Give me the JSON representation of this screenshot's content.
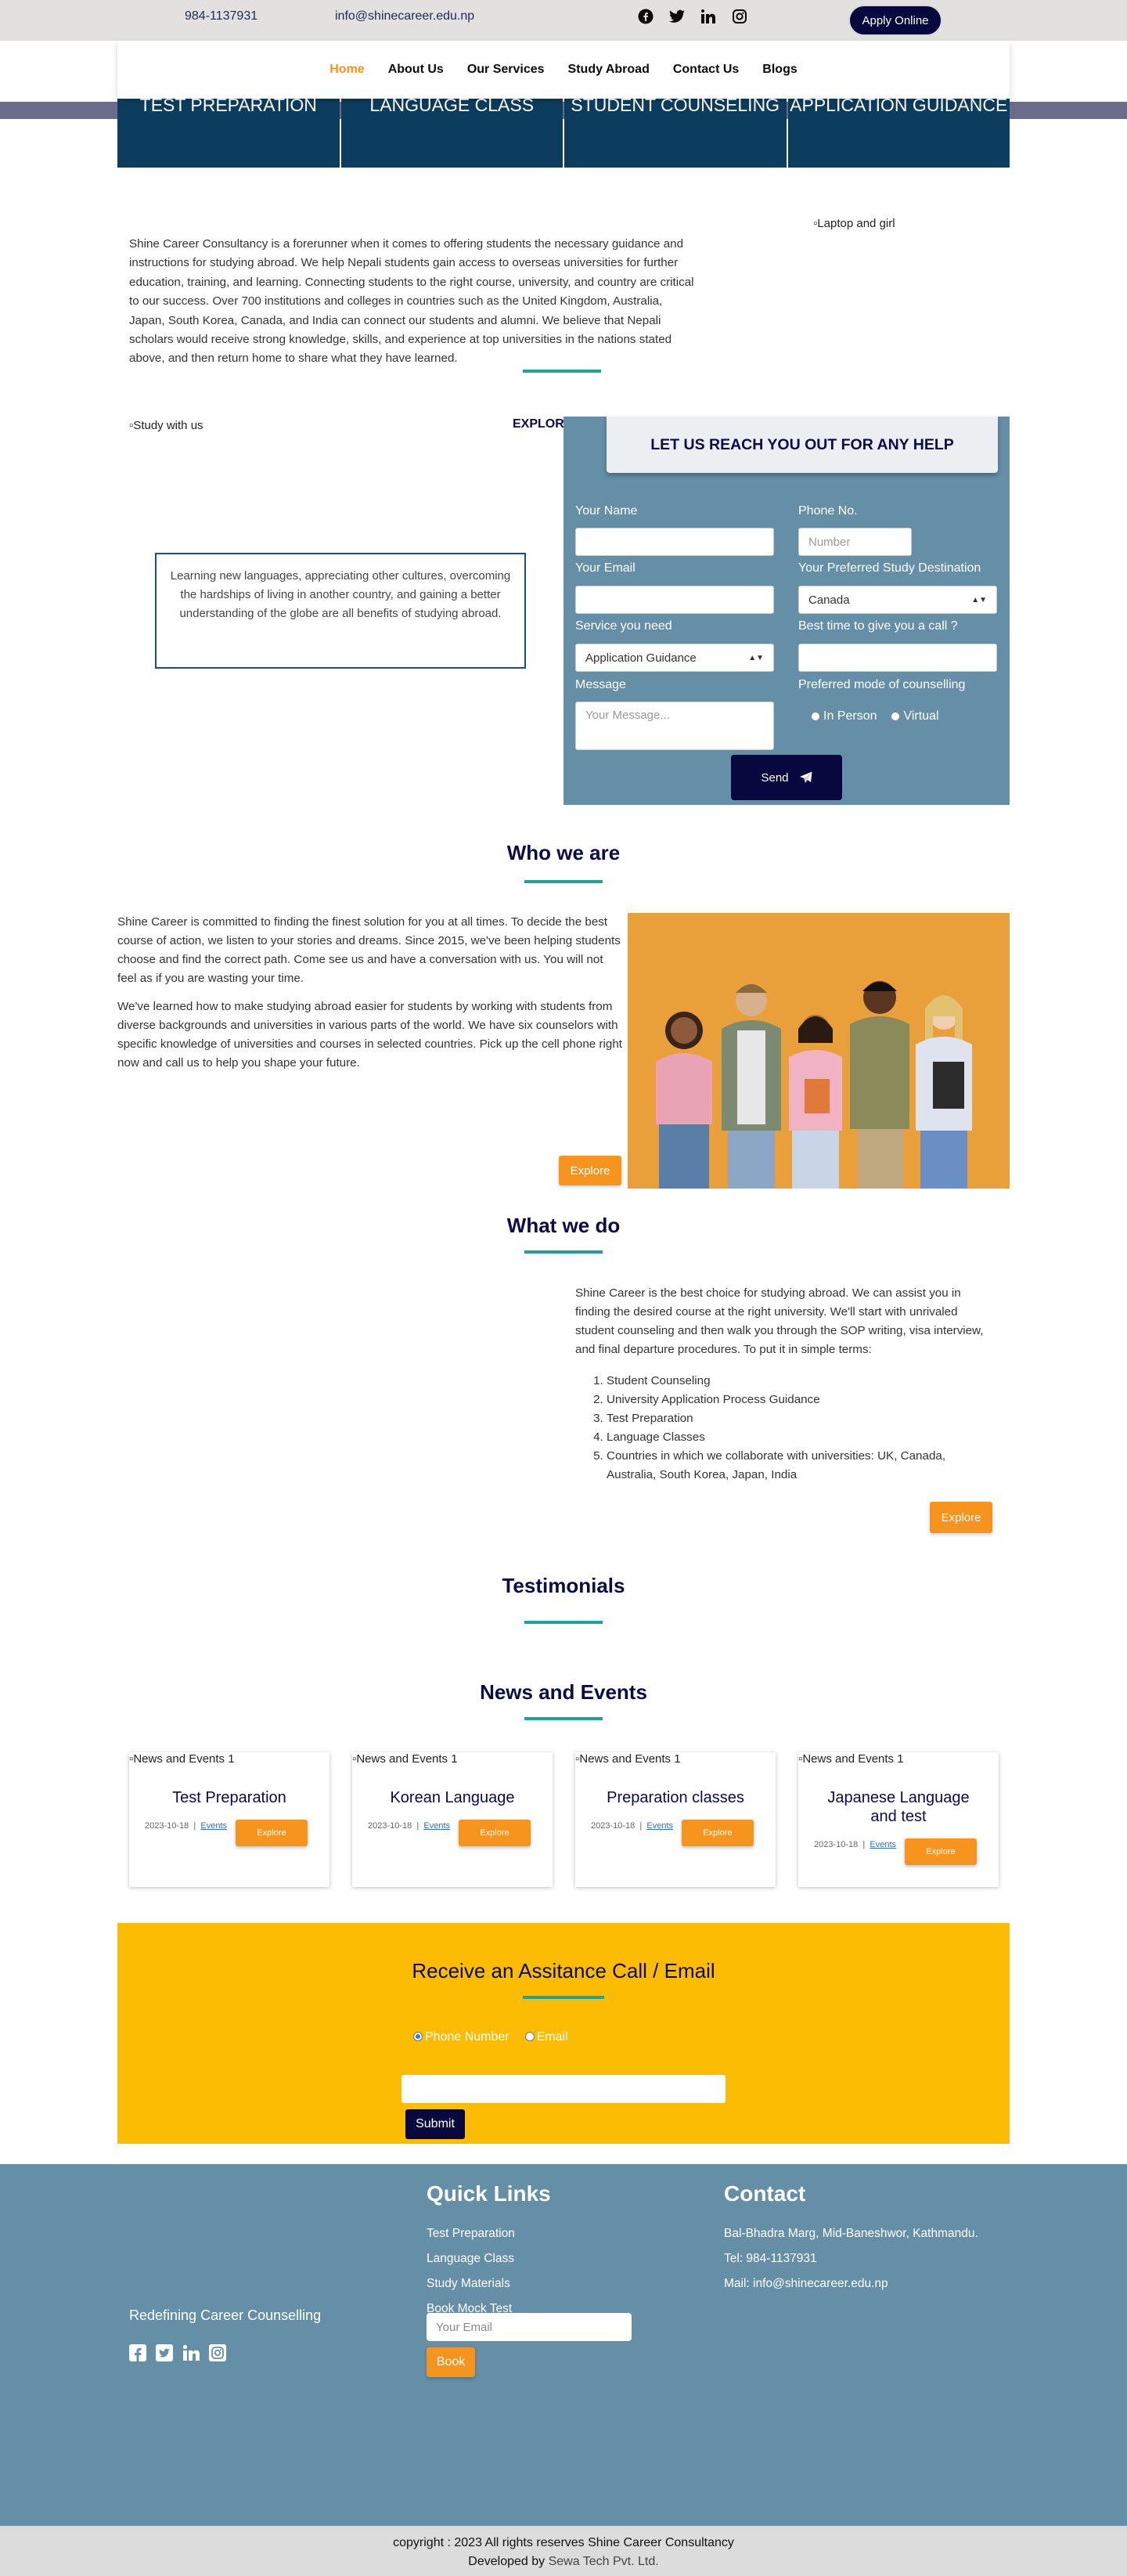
{
  "topbar": {
    "phone": "984-1137931",
    "email": "info@shinecareer.edu.np",
    "socials": [
      "facebook-icon",
      "twitter-icon",
      "linkedin-icon",
      "instagram-icon"
    ],
    "apply_label": "Apply Online"
  },
  "nav": {
    "items": [
      "Home",
      "About Us",
      "Our Services",
      "Study Abroad",
      "Contact Us",
      "Blogs"
    ],
    "active": "Home"
  },
  "tiles": [
    "TEST PREPARATION",
    "LANGUAGE CLASS",
    "STUDENT COUNSELING",
    "APPLICATION GUIDANCE"
  ],
  "intro": {
    "text": "Shine Career Consultancy is a forerunner when it comes to offering students the necessary guidance and instructions for studying abroad. We help Nepali students gain access to overseas universities for further education, training, and learning. Connecting students to the right course, university, and country are critical to our success. Over 700 institutions and colleges in countries such as the United Kingdom, Australia, Japan, South Korea, Canada, and India can connect our students and alumni. We believe that Nepali scholars would receive strong knowledge, skills, and experience at top universities in the nations stated above, and then return home to share what they have learned.",
    "image_alt": "Laptop and girl"
  },
  "study": {
    "image_alt": "Study with us",
    "explore_label": "EXPLOR",
    "quote": "Learning new languages, appreciating other cultures, overcoming the hardships of living in another country, and gaining a better understanding of the globe are all benefits of studying abroad."
  },
  "form": {
    "heading": "LET US REACH YOU OUT FOR ANY HELP",
    "name_label": "Your Name",
    "phone_label": "Phone No.",
    "phone_placeholder": "Number",
    "email_label": "Your Email",
    "destination_label": "Your Preferred Study Destination",
    "destination_value": "Canada",
    "service_label": "Service you need",
    "service_value": "Application Guidance",
    "besttime_label": "Best time to give you a call ?",
    "message_label": "Message",
    "message_placeholder": "Your Message...",
    "mode_label": "Preferred mode of counselling",
    "mode_options": [
      "In Person",
      "Virtual"
    ],
    "send_label": "Send"
  },
  "who": {
    "heading": "Who we are",
    "p1": "Shine Career is committed to finding the finest solution for you at all times. To decide the best course of action, we listen to your stories and dreams. Since 2015, we've been helping students choose and find the correct path. Come see us and have a conversation with us. You will not feel as if you are wasting your time.",
    "p2": "We've learned how to make studying abroad easier for students by working with students from diverse backgrounds and universities in various parts of the world. We have six counselors with specific knowledge of universities and courses in selected countries. Pick up the cell phone right now and call us to help you shape your future.",
    "explore_label": "Explore"
  },
  "what": {
    "heading": "What we do",
    "text": "Shine Career is the best choice for studying abroad. We can assist you in finding the desired course at the right university. We'll start with unrivaled student counseling and then walk you through the SOP writing, visa interview, and final departure procedures. To put it in simple terms:",
    "list": [
      "Student Counseling",
      "University Application Process Guidance",
      "Test Preparation",
      "Language Classes",
      "Countries in which we collaborate with universities: UK, Canada, Australia, South Korea, Japan, India"
    ],
    "explore_label": "Explore"
  },
  "testimonials": {
    "heading": "Testimonials"
  },
  "news": {
    "heading": "News and Events",
    "cards": [
      {
        "alt": "News and Events 1",
        "title": "Test Preparation",
        "date": "2023-10-18",
        "tag": "Events",
        "button": "Explore"
      },
      {
        "alt": "News and Events 1",
        "title": "Korean Language",
        "date": "2023-10-18",
        "tag": "Events",
        "button": "Explore"
      },
      {
        "alt": "News and Events 1",
        "title": "Preparation classes",
        "date": "2023-10-18",
        "tag": "Events",
        "button": "Explore"
      },
      {
        "alt": "News and Events 1",
        "title": "Japanese Language and test",
        "date": "2023-10-18",
        "tag": "Events",
        "button": "Explore"
      }
    ]
  },
  "assist": {
    "heading": "Receive an Assitance Call / Email",
    "options": [
      "Phone Number",
      "Email"
    ],
    "submit_label": "Submit"
  },
  "footer": {
    "tagline": "Redefining Career Counselling",
    "socials": [
      "facebook-square-icon",
      "twitter-square-icon",
      "linkedin-icon",
      "instagram-square-icon"
    ],
    "quick_heading": "Quick Links",
    "links": [
      "Test Preparation",
      "Language Class",
      "Study Materials",
      "Book Mock Test"
    ],
    "email_placeholder": "Your Email",
    "book_label": "Book",
    "contact_heading": "Contact",
    "address": "Bal-Bhadra Marg, Mid-Baneshwor, Kathmandu.",
    "tel": "Tel: 984-1137931",
    "mail": "Mail: info@shinecareer.edu.np"
  },
  "copyright": {
    "line1": "copyright : 2023 All rights reserves Shine Career Consultancy",
    "developed_prefix": "Developed by ",
    "developer": "Sewa Tech Pvt. Ltd."
  },
  "colors": {
    "navy": "#08083f",
    "tile": "#0d3d5e",
    "orange": "#f7941d",
    "teal": "#1ea39a",
    "panel": "#658fa7",
    "yellow": "#fcbc04"
  }
}
